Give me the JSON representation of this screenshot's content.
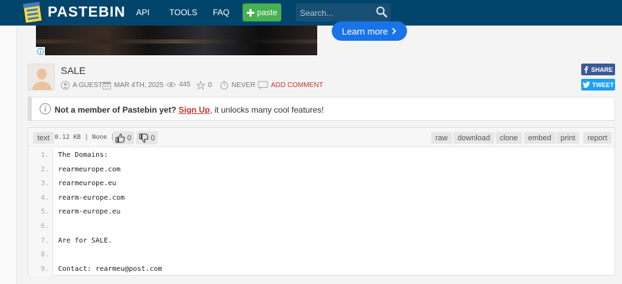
{
  "header": {
    "brand": "PASTEBIN",
    "nav": [
      "API",
      "TOOLS",
      "FAQ"
    ],
    "paste_label": "paste",
    "search_placeholder": "Search..."
  },
  "ad": {
    "cta_label": "Learn more"
  },
  "paste": {
    "title": "SALE",
    "author": "A GUEST",
    "date": "MAR 4TH, 2025",
    "views": "445",
    "stars": "0",
    "expiry": "NEVER",
    "add_comment": "ADD COMMENT"
  },
  "social": {
    "share": "SHARE",
    "tweet": "TWEET"
  },
  "notice": {
    "lead": "Not a member of Pastebin yet?",
    "link": "Sign Up",
    "rest": ", it unlocks many cool features!"
  },
  "code": {
    "syntax": "text",
    "size": "0.12 KB | None |",
    "likes": "0",
    "dislikes": "0",
    "actions": [
      "raw",
      "download",
      "clone",
      "embed",
      "print",
      "report"
    ],
    "lines": [
      "The Domains:",
      "rearmeurope.com",
      "rearmeurope.eu",
      "rearm-europe.com",
      "rearm-europe.eu",
      "",
      "Are for SALE.",
      "",
      "Contact: rearmeu@post.com"
    ]
  }
}
